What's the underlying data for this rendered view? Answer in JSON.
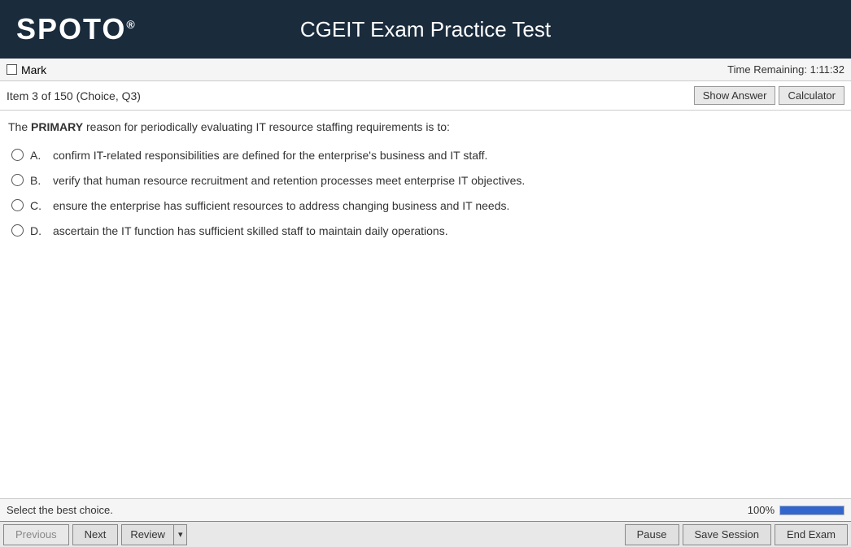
{
  "header": {
    "logo": "SPOTO",
    "logo_sup": "®",
    "title": "CGEIT Exam Practice Test"
  },
  "mark_bar": {
    "mark_label": "Mark",
    "time_label": "Time Remaining:",
    "time_value": "1:11:32"
  },
  "question_header": {
    "item_info": "Item 3 of 150 (Choice, Q3)",
    "show_answer_label": "Show Answer",
    "calculator_label": "Calculator"
  },
  "question": {
    "text_prefix": "The ",
    "text_bold": "PRIMARY",
    "text_suffix": " reason for periodically evaluating IT resource staffing requirements is to:",
    "choices": [
      {
        "letter": "A.",
        "text": "confirm IT-related responsibilities are defined for the enterprise's business and IT staff."
      },
      {
        "letter": "B.",
        "text": "verify that human resource recruitment and retention processes meet enterprise IT objectives."
      },
      {
        "letter": "C.",
        "text": "ensure the enterprise has sufficient resources to address changing business and IT needs."
      },
      {
        "letter": "D.",
        "text": "ascertain the IT function has sufficient skilled staff to maintain daily operations."
      }
    ]
  },
  "status_bar": {
    "select_text": "Select the best choice.",
    "progress_percent": "100%",
    "progress_value": 100
  },
  "nav_bar": {
    "previous_label": "Previous",
    "next_label": "Next",
    "review_label": "Review",
    "pause_label": "Pause",
    "save_session_label": "Save Session",
    "end_exam_label": "End Exam"
  }
}
